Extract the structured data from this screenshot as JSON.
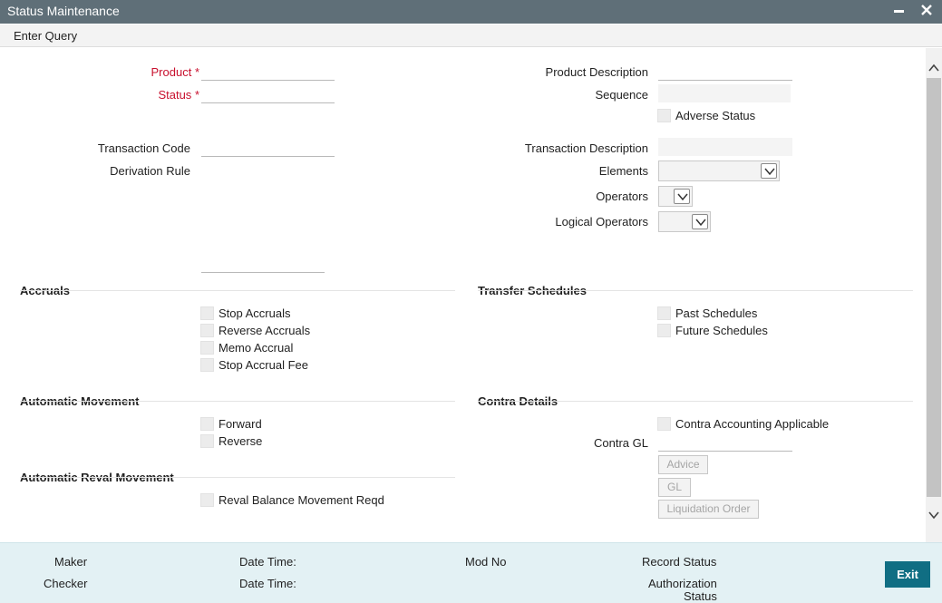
{
  "window": {
    "title": "Status Maintenance",
    "minimize_glyph": "▬",
    "close_glyph": "✕"
  },
  "menu": {
    "enter_query": "Enter Query"
  },
  "form": {
    "product_label": "Product",
    "status_label": "Status",
    "required_mark": "*",
    "product_description_label": "Product Description",
    "sequence_label": "Sequence",
    "adverse_status_label": "Adverse Status",
    "transaction_code_label": "Transaction Code",
    "derivation_rule_label": "Derivation Rule",
    "transaction_description_label": "Transaction Description",
    "elements_label": "Elements",
    "operators_label": "Operators",
    "logical_operators_label": "Logical Operators"
  },
  "accruals": {
    "heading": "Accruals",
    "items": [
      "Stop Accruals",
      "Reverse Accruals",
      "Memo Accrual",
      "Stop Accrual Fee"
    ]
  },
  "transfer_schedules": {
    "heading": "Transfer Schedules",
    "items": [
      "Past Schedules",
      "Future Schedules"
    ]
  },
  "automatic_movement": {
    "heading": "Automatic Movement",
    "items": [
      "Forward",
      "Reverse"
    ]
  },
  "contra_details": {
    "heading": "Contra Details",
    "contra_accounting_label": "Contra Accounting Applicable",
    "contra_gl_label": "Contra GL",
    "advice_button": "Advice",
    "gl_button": "GL",
    "liquidation_order_button": "Liquidation Order"
  },
  "automatic_reval_movement": {
    "heading": "Automatic Reval Movement",
    "items": [
      "Reval Balance Movement Reqd"
    ]
  },
  "footer": {
    "maker_label": "Maker",
    "checker_label": "Checker",
    "date_time_label_1": "Date Time:",
    "date_time_label_2": "Date Time:",
    "mod_no_label": "Mod No",
    "record_status_label": "Record Status",
    "authorization_status_line1": "Authorization",
    "authorization_status_line2": "Status",
    "exit_button": "Exit"
  },
  "colors": {
    "titlebar": "#5f6f78",
    "required": "#c8102e",
    "footer_bg": "#e3f1f4",
    "exit_button": "#106e83"
  }
}
